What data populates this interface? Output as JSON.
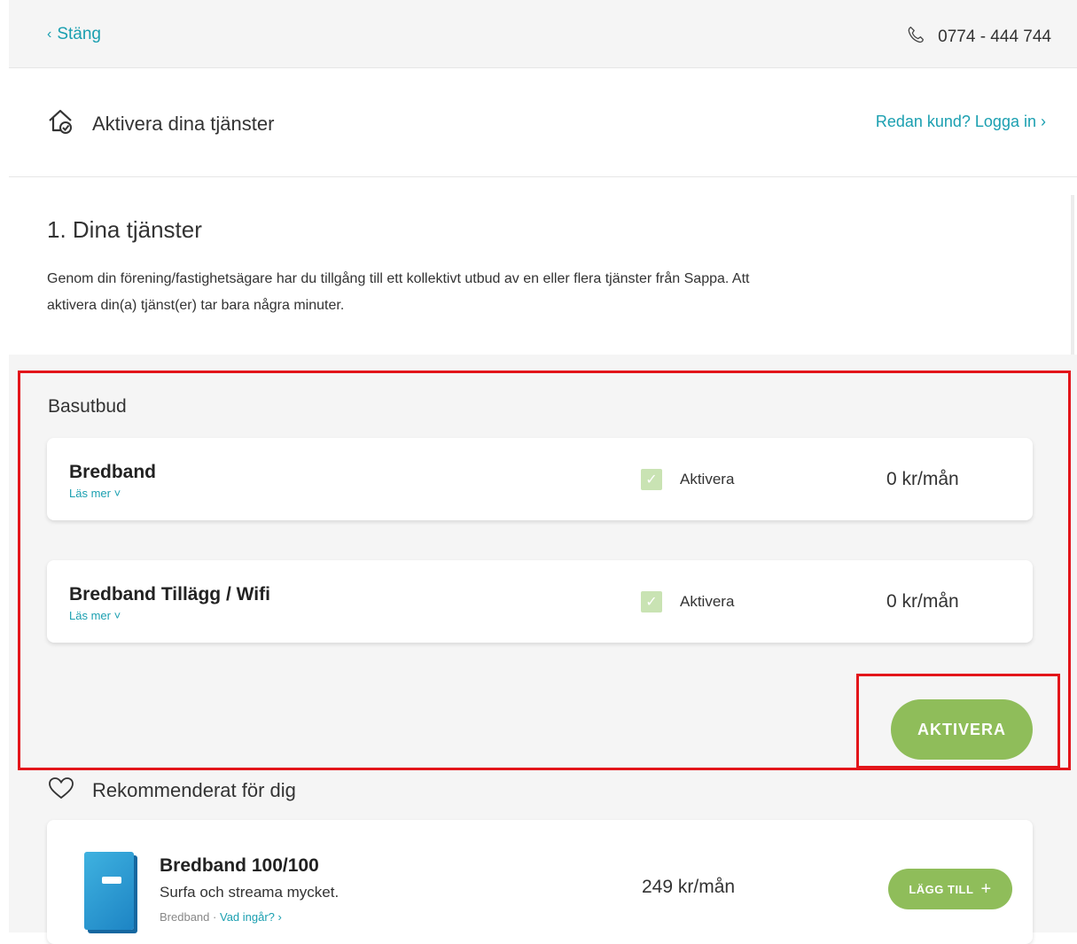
{
  "topbar": {
    "back_label": "Stäng",
    "phone_number": "0774 - 444 744"
  },
  "header": {
    "title": "Aktivera dina tjänster",
    "login_link": "Redan kund? Logga in"
  },
  "intro": {
    "heading": "1. Dina tjänster",
    "text": "Genom din förening/fastighetsägare har du tillgång till ett kollektivt utbud av en eller flera tjänster från Sappa. Att aktivera din(a) tjänst(er) tar bara några minuter."
  },
  "basutbud": {
    "label": "Basutbud",
    "services": [
      {
        "name": "Bredband",
        "more": "Läs mer",
        "check_label": "Aktivera",
        "price": "0 kr/mån",
        "checked": true
      },
      {
        "name": "Bredband Tillägg / Wifi",
        "more": "Läs mer",
        "check_label": "Aktivera",
        "price": "0 kr/mån",
        "checked": true
      }
    ],
    "activate_button": "AKTIVERA"
  },
  "recommended": {
    "title": "Rekommenderat för dig",
    "product": {
      "name": "Bredband 100/100",
      "description": "Surfa och streama mycket.",
      "category": "Bredband",
      "separator": "·",
      "details_link": "Vad ingår?",
      "price": "249 kr/mån",
      "add_button": "LÄGG TILL"
    }
  },
  "colors": {
    "accent": "#1a9fb0",
    "button_green": "#8fbd5a",
    "highlight_red": "#e3151a",
    "checkbox_green": "#c9e3b3"
  },
  "icons": {
    "back": "chevron-left-icon",
    "phone": "phone-icon",
    "home": "home-check-icon",
    "heart": "heart-icon"
  }
}
